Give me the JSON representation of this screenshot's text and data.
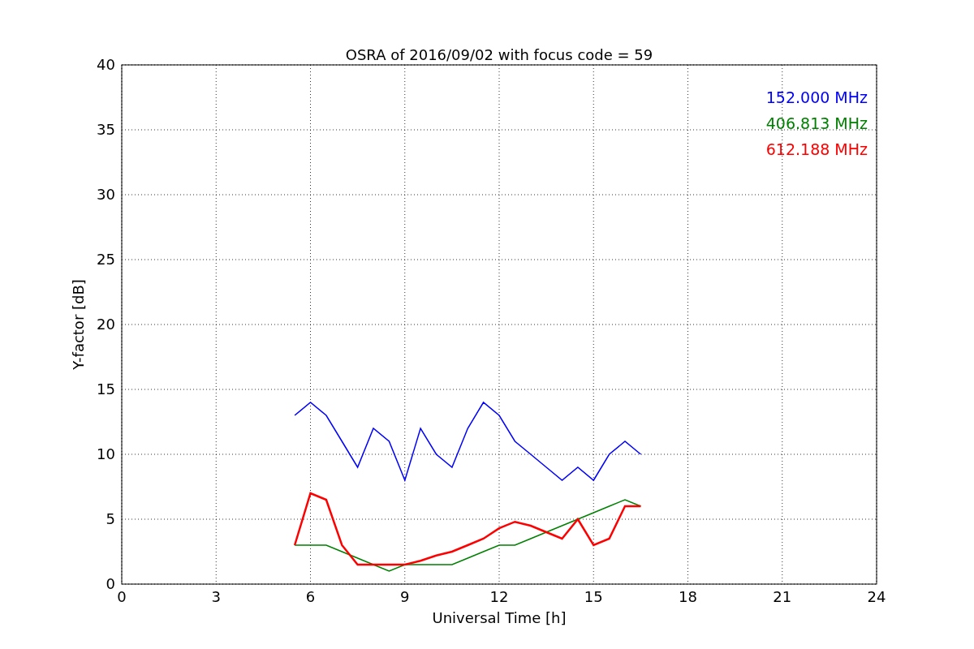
{
  "figure": {
    "chart_data": {
      "type": "line",
      "title": "OSRA of 2016/09/02 with focus code = 59",
      "xlabel": "Universal Time [h]",
      "ylabel": "Y-factor [dB]",
      "x": [
        5.5,
        6,
        6.5,
        7,
        7.5,
        8,
        8.5,
        9,
        9.5,
        10,
        10.5,
        11,
        11.5,
        12,
        12.5,
        13,
        13.5,
        14,
        14.5,
        15,
        15.5,
        16,
        16.5
      ],
      "series": [
        {
          "name": "152.000 MHz",
          "color": "#0000ff",
          "values": [
            13,
            14,
            13,
            11,
            9,
            12,
            11,
            8,
            12,
            10,
            9,
            12,
            14,
            13,
            11,
            10,
            9,
            8,
            9,
            8,
            10,
            11,
            10
          ]
        },
        {
          "name": "406.813 MHz",
          "color": "#008000",
          "values": [
            3,
            3,
            3,
            2.5,
            2,
            1.5,
            1,
            1.5,
            1.5,
            1.5,
            1.5,
            2,
            2.5,
            3,
            3,
            3.5,
            4,
            4.5,
            5,
            5.5,
            6,
            6.5,
            6
          ]
        },
        {
          "name": "612.188 MHz",
          "color": "#ff0000",
          "values": [
            3,
            7,
            6.5,
            3,
            1.5,
            1.5,
            1.5,
            1.5,
            1.8,
            2.2,
            2.5,
            3,
            3.5,
            4.3,
            4.8,
            4.5,
            4,
            3.5,
            5,
            3,
            3.5,
            6,
            6
          ]
        }
      ],
      "grid": true,
      "xlim": [
        0,
        24
      ],
      "ylim": [
        0,
        40
      ],
      "xticks": [
        0,
        3,
        6,
        9,
        12,
        15,
        18,
        21,
        24
      ],
      "yticks": [
        0,
        5,
        10,
        15,
        20,
        25,
        30,
        35,
        40
      ]
    }
  }
}
